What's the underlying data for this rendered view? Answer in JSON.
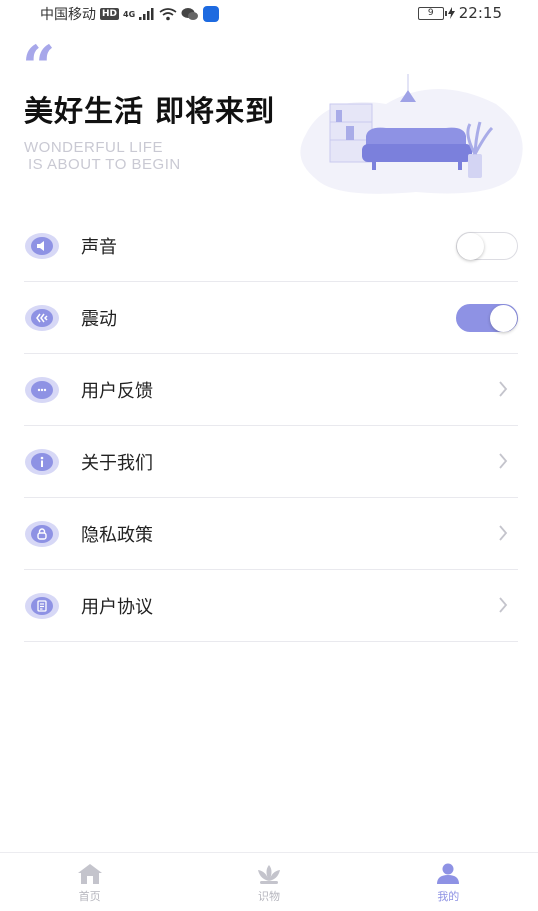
{
  "status_bar": {
    "carrier": "中国移动",
    "hd": "HD",
    "network": "4G",
    "battery": "9",
    "time": "22:15"
  },
  "header": {
    "quote_mark": "“",
    "title": "美好生活 即将来到",
    "subtitle_line1": "WONDERFUL LIFE",
    "subtitle_line2": "IS ABOUT TO BEGIN"
  },
  "settings": [
    {
      "label": "声音",
      "icon": "speaker-icon",
      "control": "toggle",
      "on": false
    },
    {
      "label": "震动",
      "icon": "vibrate-icon",
      "control": "toggle",
      "on": true
    },
    {
      "label": "用户反馈",
      "icon": "chat-bubble-icon",
      "control": "chevron"
    },
    {
      "label": "关于我们",
      "icon": "info-icon",
      "control": "chevron"
    },
    {
      "label": "隐私政策",
      "icon": "lock-icon",
      "control": "chevron"
    },
    {
      "label": "用户协议",
      "icon": "document-icon",
      "control": "chevron"
    }
  ],
  "tabbar": {
    "tabs": [
      {
        "label": "首页",
        "icon": "home-icon",
        "active": false
      },
      {
        "label": "识物",
        "icon": "lotus-icon",
        "active": false
      },
      {
        "label": "我的",
        "icon": "person-icon",
        "active": true
      }
    ]
  },
  "colors": {
    "accent": "#8e92e4",
    "accent_light": "#d7d8f6",
    "divider": "#e9e9ee"
  }
}
